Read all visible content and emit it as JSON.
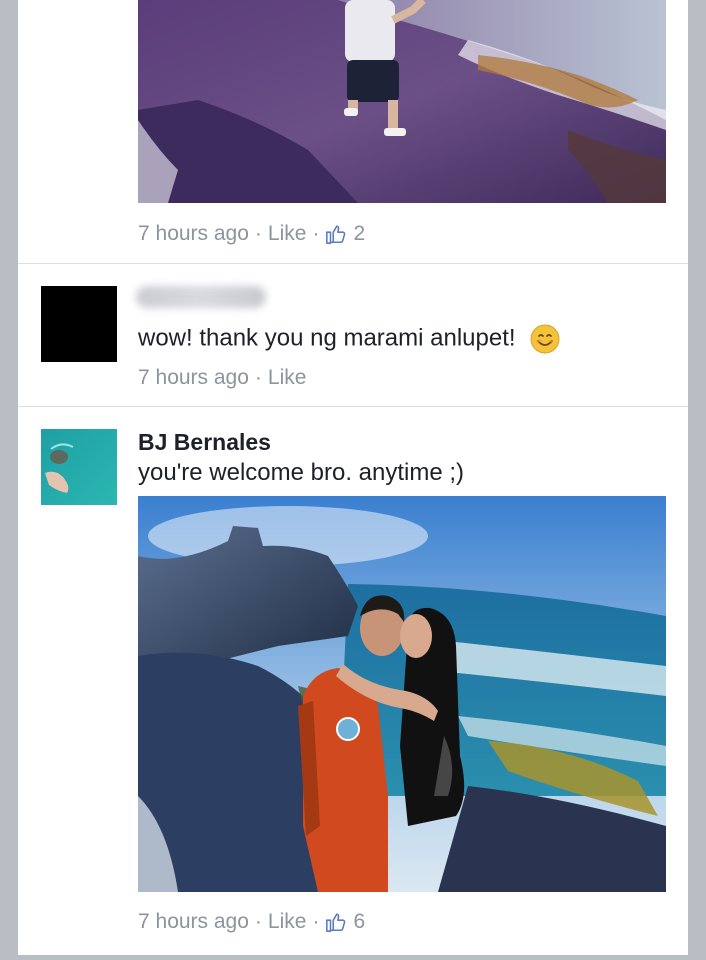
{
  "comments": [
    {
      "timestamp": "7 hours ago",
      "like_label": "Like",
      "like_count": "2"
    },
    {
      "author": "",
      "text": "wow! thank you ng marami anlupet!",
      "emoji": "smiling-face-emoji",
      "timestamp": "7 hours ago",
      "like_label": "Like"
    },
    {
      "author": "BJ Bernales",
      "text": "you're welcome bro. anytime ;)",
      "timestamp": "7 hours ago",
      "like_label": "Like",
      "like_count": "6"
    }
  ],
  "separator": "·",
  "colors": {
    "page_bg": "#b9bdc4",
    "card_bg": "#ffffff",
    "text": "#1d2129",
    "meta": "#8d949e",
    "divider": "#dcdee3"
  },
  "icons": [
    "thumbs-up-icon",
    "smiling-face-emoji"
  ]
}
